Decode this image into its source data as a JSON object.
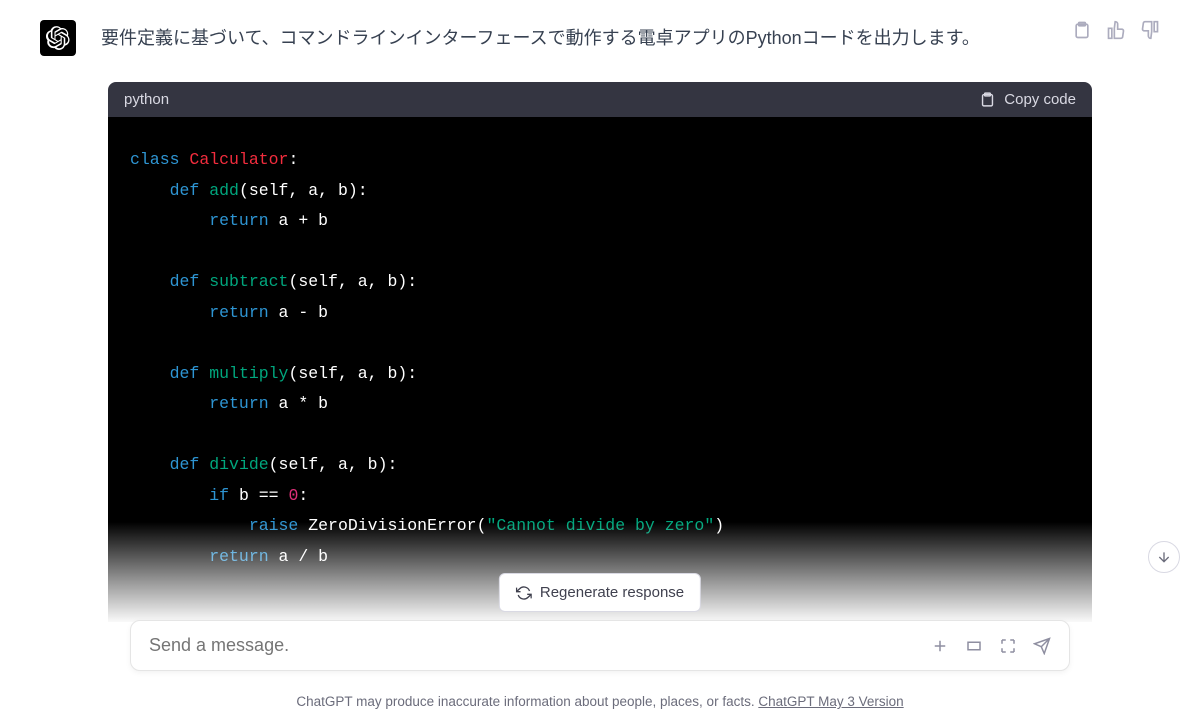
{
  "intro_text": "要件定義に基づいて、コマンドラインインターフェースで動作する電卓アプリのPythonコードを出力します。",
  "code_block": {
    "language": "python",
    "copy_label": "Copy code",
    "code": {
      "class_kw": "class",
      "class_name": "Calculator",
      "def_kw": "def",
      "return_kw": "return",
      "if_kw": "if",
      "raise_kw": "raise",
      "fn_add": "add",
      "fn_subtract": "subtract",
      "fn_multiply": "multiply",
      "fn_divide": "divide",
      "sig": "(self, a, b):",
      "ret_add": "a + b",
      "ret_sub": "a - b",
      "ret_mul": "a * b",
      "ret_div": "a / b",
      "cond": "b == ",
      "zero": "0",
      "cond_colon": ":",
      "err_cls": "ZeroDivisionError",
      "err_open": "(",
      "err_str": "\"Cannot divide by zero\"",
      "err_close": ")",
      "colon": ":"
    }
  },
  "regenerate_label": "Regenerate response",
  "input": {
    "placeholder": "Send a message."
  },
  "disclaimer": {
    "text": "ChatGPT may produce inaccurate information about people, places, or facts. ",
    "link_text": "ChatGPT May 3 Version"
  }
}
